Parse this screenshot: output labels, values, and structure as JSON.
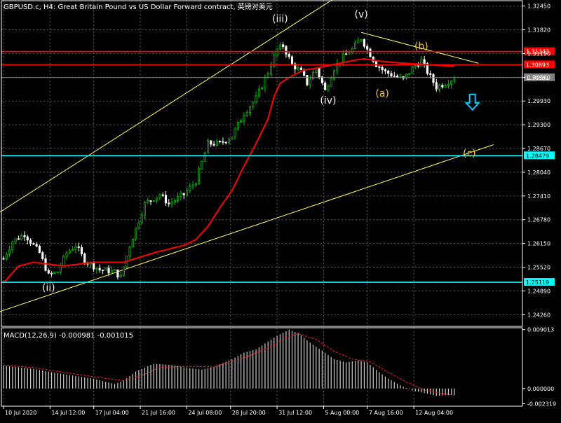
{
  "chart_data": [
    {
      "type": "candlestick",
      "title": "GBPUSD.c, H4:  Great Britain Pound vs US Dollar Forward contract, 英镑对美元",
      "colors": {
        "background": "#000000",
        "bull": "#00c000",
        "bear": "#ffffff",
        "ma": "#ff0000",
        "channel": "#ffff66",
        "resistance": "#ff0000",
        "support": "#00ffff",
        "current_price": "#808080",
        "annotation": "#f0f0f0",
        "wave_abc": "#f0c040",
        "arrow": "#00ccff"
      },
      "ylim": [
        1.2395,
        1.3261
      ],
      "y_ticks": [
        "1.32450",
        "1.31820",
        "1.31190",
        "1.30560",
        "1.29930",
        "1.29300",
        "1.28670",
        "1.28040",
        "1.27410",
        "1.26780",
        "1.26150",
        "1.25520",
        "1.24890",
        "1.24260"
      ],
      "x_ticks": [
        "10 Jul 2020",
        "14 Jul 12:00",
        "17 Jul 04:00",
        "21 Jul 16:00",
        "24 Jul 08:00",
        "28 Jul 20:00",
        "31 Jul 12:00",
        "5 Aug 00:00",
        "7 Aug 16:00",
        "12 Aug 04:00"
      ],
      "bar_count": 151,
      "price_path": [
        [
          0,
          1.2575
        ],
        [
          3,
          1.262
        ],
        [
          7,
          1.264
        ],
        [
          12,
          1.259
        ],
        [
          15,
          1.253
        ],
        [
          18,
          1.254
        ],
        [
          21,
          1.259
        ],
        [
          24,
          1.261
        ],
        [
          27,
          1.257
        ],
        [
          32,
          1.2545
        ],
        [
          37,
          1.254
        ],
        [
          39,
          1.2525
        ],
        [
          42,
          1.261
        ],
        [
          47,
          1.272
        ],
        [
          52,
          1.2745
        ],
        [
          55,
          1.272
        ],
        [
          60,
          1.2745
        ],
        [
          64,
          1.278
        ],
        [
          68,
          1.288
        ],
        [
          72,
          1.288
        ],
        [
          76,
          1.29
        ],
        [
          80,
          1.296
        ],
        [
          84,
          1.3
        ],
        [
          88,
          1.307
        ],
        [
          91,
          1.313
        ],
        [
          93,
          1.314
        ],
        [
          96,
          1.309
        ],
        [
          99,
          1.307
        ],
        [
          101,
          1.304
        ],
        [
          104,
          1.308
        ],
        [
          107,
          1.302
        ],
        [
          110,
          1.308
        ],
        [
          113,
          1.311
        ],
        [
          116,
          1.313
        ],
        [
          119,
          1.316
        ],
        [
          121,
          1.313
        ],
        [
          124,
          1.309
        ],
        [
          127,
          1.307
        ],
        [
          130,
          1.306
        ],
        [
          133,
          1.305
        ],
        [
          136,
          1.308
        ],
        [
          139,
          1.31
        ],
        [
          141,
          1.307
        ],
        [
          144,
          1.303
        ],
        [
          147,
          1.304
        ],
        [
          150,
          1.3055
        ]
      ],
      "ma_path": [
        [
          0,
          1.251
        ],
        [
          5,
          1.2555
        ],
        [
          10,
          1.2565
        ],
        [
          20,
          1.2555
        ],
        [
          30,
          1.2565
        ],
        [
          40,
          1.2565
        ],
        [
          50,
          1.259
        ],
        [
          60,
          1.261
        ],
        [
          64,
          1.2625
        ],
        [
          68,
          1.266
        ],
        [
          72,
          1.271
        ],
        [
          76,
          1.2755
        ],
        [
          80,
          1.282
        ],
        [
          84,
          1.288
        ],
        [
          88,
          1.2945
        ],
        [
          90,
          1.3005
        ],
        [
          92,
          1.304
        ],
        [
          96,
          1.306
        ],
        [
          100,
          1.3075
        ],
        [
          104,
          1.308
        ],
        [
          110,
          1.309
        ],
        [
          116,
          1.31
        ],
        [
          120,
          1.3105
        ],
        [
          124,
          1.31
        ],
        [
          130,
          1.3095
        ],
        [
          140,
          1.309
        ],
        [
          150,
          1.3085
        ]
      ],
      "horizontal_lines": [
        {
          "label": "1.31243",
          "price": 1.31243,
          "role": "resistance"
        },
        {
          "label": "1.30893",
          "price": 1.30893,
          "role": "resistance"
        },
        {
          "label": "1.30551",
          "price": 1.30551,
          "role": "current"
        },
        {
          "label": "1.28479",
          "price": 1.28479,
          "role": "support"
        },
        {
          "label": "1.25119",
          "price": 1.25119,
          "role": "support"
        }
      ],
      "trend_lines": [
        {
          "x1": -2,
          "y1": 1.2694,
          "x2": 111,
          "y2": 1.327
        },
        {
          "x1": -2,
          "y1": 1.2432,
          "x2": 163,
          "y2": 1.2877
        },
        {
          "x1": 119,
          "y1": 1.3175,
          "x2": 158,
          "y2": 1.3093
        }
      ],
      "annotations": [
        {
          "text": "(ii)",
          "x": 15,
          "price": 1.2489,
          "style": "wave"
        },
        {
          "text": "(iii)",
          "x": 92,
          "price": 1.3202,
          "style": "wave"
        },
        {
          "text": "(iv)",
          "x": 108,
          "price": 1.2986,
          "style": "wave"
        },
        {
          "text": "(v)",
          "x": 119,
          "price": 1.3215,
          "style": "wave"
        },
        {
          "text": "(a)",
          "x": 126,
          "price": 1.3005,
          "style": "abc"
        },
        {
          "text": "(b)",
          "x": 139,
          "price": 1.313,
          "style": "abc"
        },
        {
          "text": "(c)",
          "x": 155,
          "price": 1.2846,
          "style": "abc"
        }
      ],
      "arrow": {
        "x": 156,
        "price": 1.2988,
        "direction": "down"
      }
    },
    {
      "type": "bar",
      "title": "MACD(12,26,9) -0.000981 -0.001015",
      "ylim": [
        -0.0027,
        0.0093
      ],
      "y_ticks": [
        "0.009013",
        "0.000000",
        "-0.002319"
      ],
      "histogram_path": [
        [
          0,
          0.0035
        ],
        [
          10,
          0.003
        ],
        [
          20,
          0.0022
        ],
        [
          30,
          0.0015
        ],
        [
          37,
          0.0007
        ],
        [
          40,
          0.0012
        ],
        [
          44,
          0.0026
        ],
        [
          50,
          0.0038
        ],
        [
          56,
          0.0036
        ],
        [
          62,
          0.0031
        ],
        [
          66,
          0.0029
        ],
        [
          70,
          0.0033
        ],
        [
          76,
          0.0045
        ],
        [
          80,
          0.0055
        ],
        [
          84,
          0.006
        ],
        [
          88,
          0.0072
        ],
        [
          92,
          0.0083
        ],
        [
          95,
          0.009
        ],
        [
          98,
          0.0085
        ],
        [
          102,
          0.007
        ],
        [
          106,
          0.0058
        ],
        [
          110,
          0.0045
        ],
        [
          114,
          0.004
        ],
        [
          118,
          0.0043
        ],
        [
          121,
          0.004
        ],
        [
          125,
          0.0025
        ],
        [
          128,
          0.0015
        ],
        [
          132,
          0.0005
        ],
        [
          136,
          -0.0003
        ],
        [
          140,
          -0.0007
        ],
        [
          144,
          -0.0011
        ],
        [
          148,
          -0.001
        ],
        [
          150,
          -0.001
        ]
      ],
      "signal_path": [
        [
          0,
          0.0036
        ],
        [
          10,
          0.0032
        ],
        [
          20,
          0.0025
        ],
        [
          30,
          0.0018
        ],
        [
          40,
          0.0012
        ],
        [
          46,
          0.002
        ],
        [
          52,
          0.0032
        ],
        [
          60,
          0.0034
        ],
        [
          70,
          0.0033
        ],
        [
          80,
          0.0047
        ],
        [
          88,
          0.0062
        ],
        [
          94,
          0.0078
        ],
        [
          98,
          0.0084
        ],
        [
          104,
          0.0075
        ],
        [
          110,
          0.0057
        ],
        [
          116,
          0.0045
        ],
        [
          122,
          0.0041
        ],
        [
          128,
          0.0025
        ],
        [
          134,
          0.001
        ],
        [
          140,
          -0.0002
        ],
        [
          146,
          -0.0008
        ],
        [
          150,
          -0.001
        ]
      ]
    }
  ]
}
